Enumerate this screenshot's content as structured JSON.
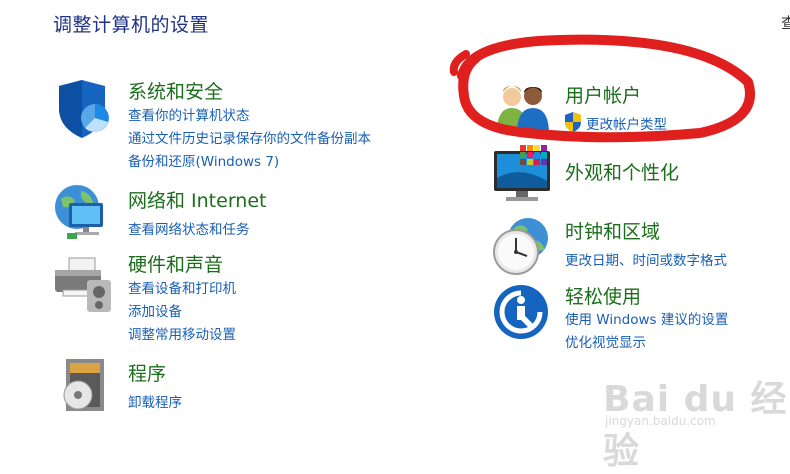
{
  "page": {
    "title": "调整计算机的设置",
    "edge_char": "查"
  },
  "categories": {
    "system": {
      "title": "系统和安全",
      "icon": "shield-icon",
      "links": [
        "查看你的计算机状态",
        "通过文件历史记录保存你的文件备份副本",
        "备份和还原(Windows 7)"
      ]
    },
    "network": {
      "title": "网络和 Internet",
      "icon": "globe-network-icon",
      "links": [
        "查看网络状态和任务"
      ]
    },
    "hardware": {
      "title": "硬件和声音",
      "icon": "printer-speaker-icon",
      "links": [
        "查看设备和打印机",
        "添加设备",
        "调整常用移动设置"
      ]
    },
    "programs": {
      "title": "程序",
      "icon": "program-disc-icon",
      "links": [
        "卸载程序"
      ]
    },
    "accounts": {
      "title": "用户帐户",
      "icon": "users-icon",
      "links": [
        "更改帐户类型"
      ]
    },
    "appearance": {
      "title": "外观和个性化",
      "icon": "monitor-icon",
      "links": []
    },
    "clock": {
      "title": "时钟和区域",
      "icon": "clock-globe-icon",
      "links": [
        "更改日期、时间或数字格式"
      ]
    },
    "ease": {
      "title": "轻松使用",
      "icon": "ease-of-access-icon",
      "links": [
        "使用 Windows 建议的设置",
        "优化视觉显示"
      ]
    }
  },
  "watermark": {
    "main": "Bai du 经验",
    "sub": "jingyan.baidu.com"
  },
  "colors": {
    "category_title": "#1b6e1b",
    "link": "#1a5fb4",
    "heading": "#1e3287",
    "annotation": "#e0201e"
  }
}
